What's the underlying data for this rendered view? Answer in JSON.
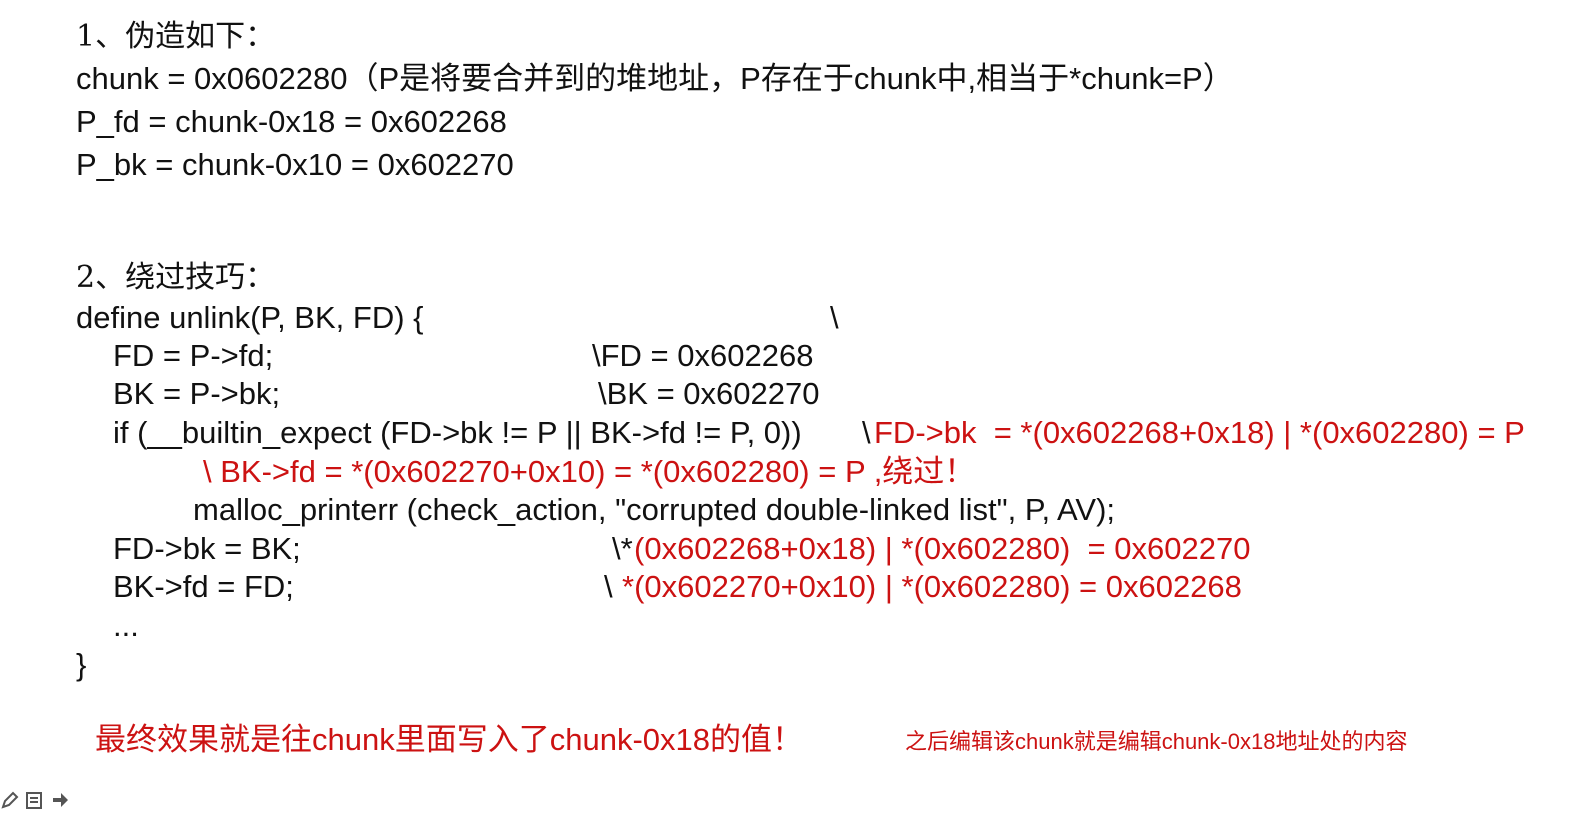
{
  "section1": {
    "heading": "1、伪造如下：",
    "lines": [
      "chunk = 0x0602280（P是将要合并到的堆地址，P存在于chunk中,相当于*chunk=P）",
      "P_fd = chunk-0x18 = 0x602268",
      "P_bk = chunk-0x10 = 0x602270"
    ]
  },
  "section2": {
    "heading": "2、绕过技巧：",
    "code": {
      "define": "define unlink(P, BK, FD) {",
      "define_cont": "\\",
      "fd_assign": "FD = P->fd;",
      "fd_note": "\\FD = 0x602268",
      "bk_assign": "BK = P->bk;",
      "bk_note": "\\BK = 0x602270",
      "if_line": "if (__builtin_expect (FD->bk != P || BK->fd != P, 0))",
      "if_note_slash": "\\",
      "if_note": "FD->bk  = *(0x602268+0x18) | *(0x602280) = P",
      "bypass_note": "\\ BK->fd = *(0x602270+0x10) = *(0x602280) = P ,绕过！",
      "malloc_line": "malloc_printerr (check_action, \"corrupted double-linked list\", P, AV);",
      "fdbk_assign": "FD->bk = BK;",
      "fdbk_note_slash": "\\*",
      "fdbk_note": "(0x602268+0x18) | *(0x602280)  = 0x602270",
      "bkfd_assign": "BK->fd = FD;",
      "bkfd_note_slash": "\\",
      "bkfd_note": "*(0x602270+0x10) | *(0x602280) = 0x602268",
      "ellipsis": "...",
      "close": "}"
    }
  },
  "conclusion": {
    "main": "最终效果就是往chunk里面写入了chunk-0x18的值！",
    "side": "之后编辑该chunk就是编辑chunk-0x18地址处的内容"
  },
  "toolbar": {
    "icons": [
      "pen-icon",
      "page-icon",
      "arrow-icon"
    ]
  },
  "colors": {
    "text": "#111111",
    "highlight": "#cc1212"
  }
}
